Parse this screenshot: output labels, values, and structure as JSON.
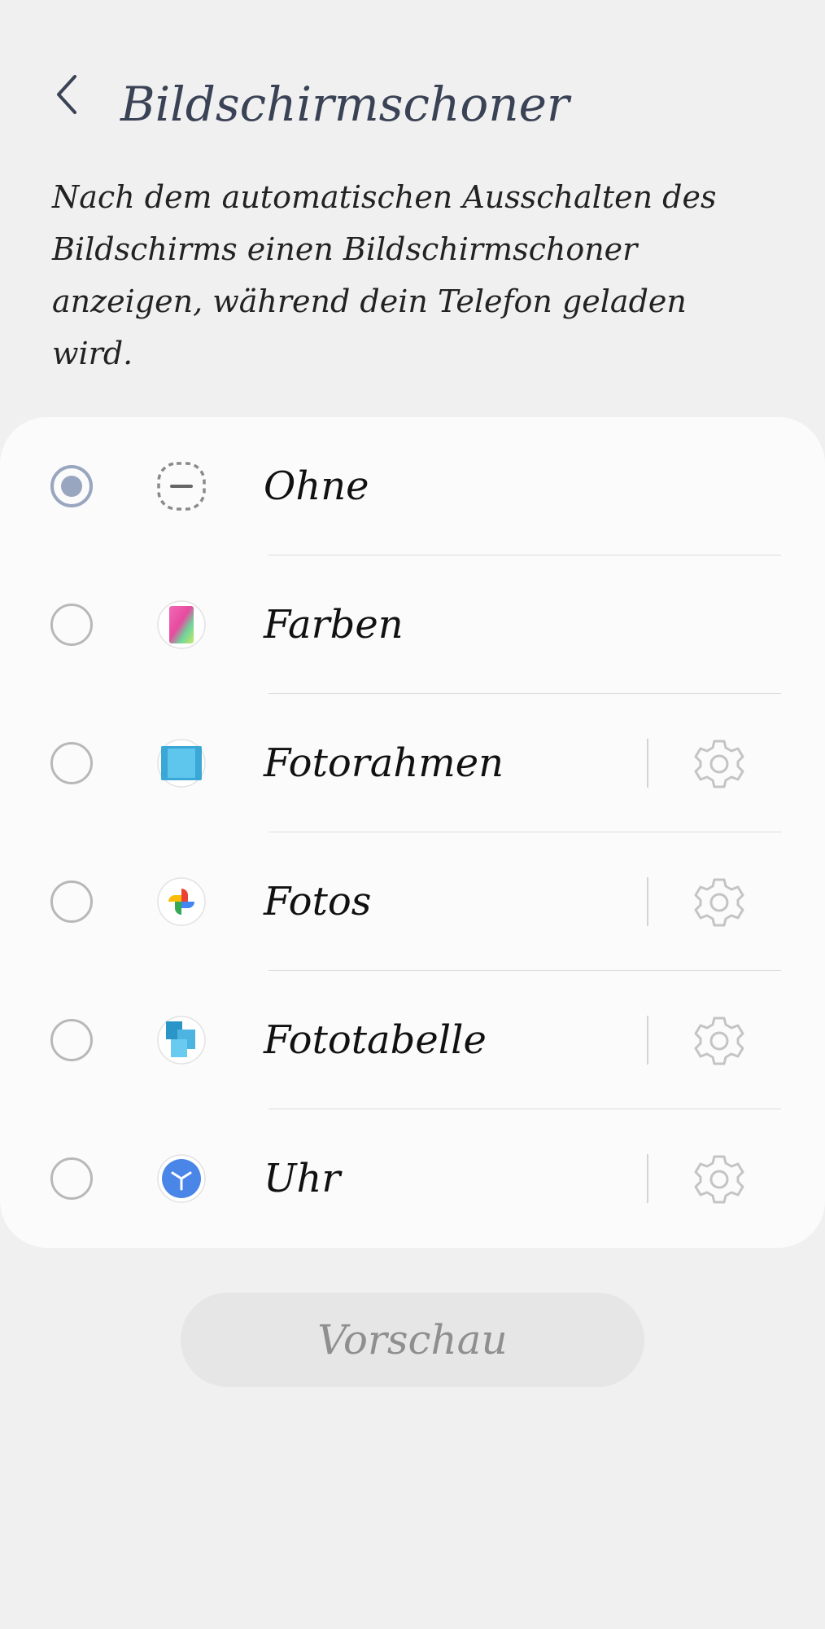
{
  "header": {
    "title": "Bildschirmschoner",
    "back_icon": "chevron-left-icon"
  },
  "description": "Nach dem automatischen Ausschalten des Bildschirms einen Bildschirmschoner anzeigen, während dein Telefon geladen wird.",
  "options": [
    {
      "label": "Ohne",
      "icon": "none-icon",
      "selected": true,
      "has_settings": false
    },
    {
      "label": "Farben",
      "icon": "colors-icon",
      "selected": false,
      "has_settings": false
    },
    {
      "label": "Fotorahmen",
      "icon": "photo-frame-icon",
      "selected": false,
      "has_settings": true
    },
    {
      "label": "Fotos",
      "icon": "google-photos-icon",
      "selected": false,
      "has_settings": true
    },
    {
      "label": "Fototabelle",
      "icon": "photo-table-icon",
      "selected": false,
      "has_settings": true
    },
    {
      "label": "Uhr",
      "icon": "clock-icon",
      "selected": false,
      "has_settings": true
    }
  ],
  "settings_icon": "gear-icon",
  "preview_button": "Vorschau",
  "colors": {
    "background": "#f0f0f0",
    "card": "#fbfbfb",
    "radio_selected": "#98a6bf",
    "title": "#3a4255"
  }
}
